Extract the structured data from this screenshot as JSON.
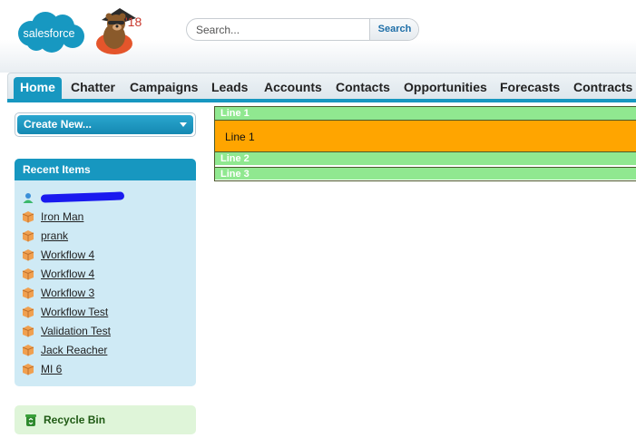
{
  "header": {
    "logo_text": "salesforce",
    "release_badge": "'18",
    "search": {
      "placeholder": "Search...",
      "button_label": "Search"
    }
  },
  "tabs": [
    {
      "label": "Home",
      "active": true
    },
    {
      "label": "Chatter"
    },
    {
      "label": "Campaigns"
    },
    {
      "label": "Leads"
    },
    {
      "label": "Accounts"
    },
    {
      "label": "Contacts"
    },
    {
      "label": "Opportunities"
    },
    {
      "label": "Forecasts"
    },
    {
      "label": "Contracts"
    }
  ],
  "sidebar": {
    "create_new_label": "Create New...",
    "recent_items": {
      "title": "Recent Items",
      "items": [
        {
          "label": "",
          "icon": "user-icon",
          "redacted": true
        },
        {
          "label": "Iron Man",
          "icon": "box-icon"
        },
        {
          "label": "prank",
          "icon": "box-icon"
        },
        {
          "label": "Workflow 4",
          "icon": "box-icon"
        },
        {
          "label": "Workflow 4",
          "icon": "box-icon"
        },
        {
          "label": "Workflow 3",
          "icon": "box-icon"
        },
        {
          "label": "Workflow Test",
          "icon": "box-icon"
        },
        {
          "label": "Validation Test",
          "icon": "box-icon"
        },
        {
          "label": "Jack Reacher",
          "icon": "box-icon"
        },
        {
          "label": "MI 6",
          "icon": "box-icon"
        }
      ]
    },
    "recycle_bin_label": "Recycle Bin"
  },
  "main": {
    "line1_header": "Line 1",
    "line1_body": "Line 1",
    "line2_header": "Line 2",
    "line3_header": "Line 3"
  },
  "colors": {
    "accent": "#1797c0",
    "line_header": "#90e890",
    "line_body": "#ffa500",
    "recent_panel": "#cfeaf5",
    "recycle_panel": "#dff5d9",
    "redaction": "#1a1aef"
  }
}
